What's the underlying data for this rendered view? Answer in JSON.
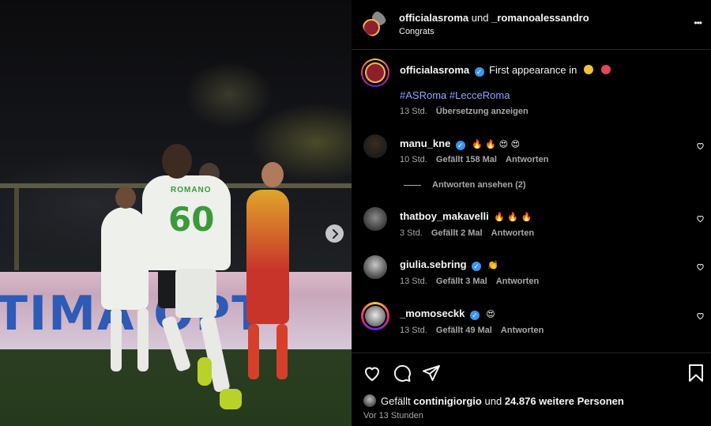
{
  "header": {
    "user1": "officialasroma",
    "connector": "und",
    "user2": "_romanoalessandro",
    "subtitle": "Congrats",
    "more": "•••"
  },
  "post": {
    "author": "officialasroma",
    "caption": "First appearance in",
    "hashtags": "#ASRoma #LecceRoma",
    "age": "13 Std.",
    "translate": "Übersetzung anzeigen"
  },
  "comments": [
    {
      "user": "manu_kne",
      "verified": true,
      "text": "🔥 🔥 😍 😍",
      "age": "10 Std.",
      "likes": "Gefällt 158 Mal",
      "reply": "Antworten",
      "view_replies": "Antworten ansehen (2)"
    },
    {
      "user": "thatboy_makavelli",
      "verified": false,
      "text": "🔥 🔥 🔥",
      "age": "3 Std.",
      "likes": "Gefällt 2 Mal",
      "reply": "Antworten"
    },
    {
      "user": "giulia.sebring",
      "verified": true,
      "text": "👏",
      "age": "13 Std.",
      "likes": "Gefällt 3 Mal",
      "reply": "Antworten"
    },
    {
      "user": "_momoseckk",
      "verified": true,
      "text": "😍",
      "age": "13 Std.",
      "likes": "Gefällt 49 Mal",
      "reply": "Antworten"
    }
  ],
  "footer": {
    "likes_prefix": "Gefällt",
    "likes_user": "continigiorgio",
    "likes_middle": "und",
    "likes_count": "24.876 weitere Personen",
    "time": "Vor 13 Stunden"
  },
  "media": {
    "jersey_name": "ROMANO",
    "jersey_number": "60",
    "board_text": "TIMA  OPT"
  },
  "icons": {
    "like": "heart-icon",
    "comment": "comment-icon",
    "share": "send-icon",
    "save": "bookmark-icon",
    "next": "chevron-right-icon"
  },
  "colors": {
    "accent_link": "#8ea6ff",
    "verified": "#3897f0",
    "roma_red": "#8e1f2f",
    "roma_gold": "#f0bc42"
  }
}
